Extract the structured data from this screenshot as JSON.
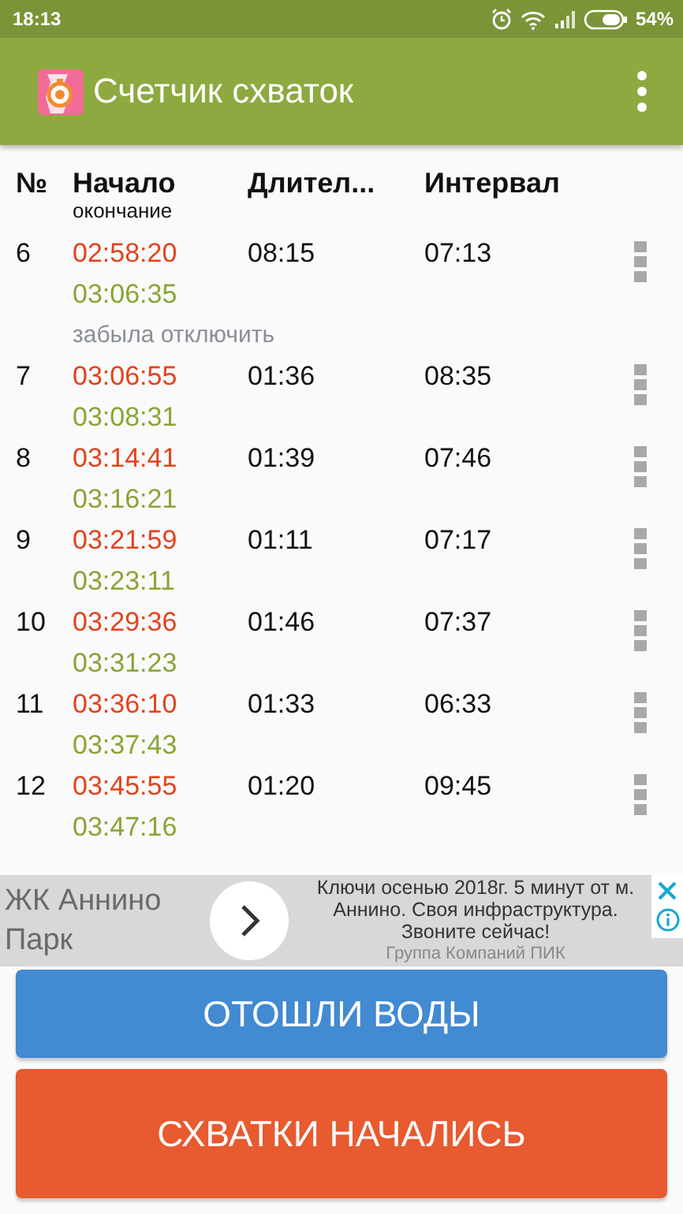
{
  "status_bar": {
    "time": "18:13",
    "battery": "54%"
  },
  "app_bar": {
    "title": "Счетчик схваток"
  },
  "table": {
    "columns": [
      {
        "label": "№"
      },
      {
        "label": "Начало",
        "sublabel": "окончание"
      },
      {
        "label": "Длител..."
      },
      {
        "label": "Интервал"
      }
    ],
    "rows": [
      {
        "number": "6",
        "start": "02:58:20",
        "end": "03:06:35",
        "duration": "08:15",
        "interval": "07:13",
        "note": "забыла отключить"
      },
      {
        "number": "7",
        "start": "03:06:55",
        "end": "03:08:31",
        "duration": "01:36",
        "interval": "08:35"
      },
      {
        "number": "8",
        "start": "03:14:41",
        "end": "03:16:21",
        "duration": "01:39",
        "interval": "07:46"
      },
      {
        "number": "9",
        "start": "03:21:59",
        "end": "03:23:11",
        "duration": "01:11",
        "interval": "07:17"
      },
      {
        "number": "10",
        "start": "03:29:36",
        "end": "03:31:23",
        "duration": "01:46",
        "interval": "07:37"
      },
      {
        "number": "11",
        "start": "03:36:10",
        "end": "03:37:43",
        "duration": "01:33",
        "interval": "06:33"
      },
      {
        "number": "12",
        "start": "03:45:55",
        "end": "03:47:16",
        "duration": "01:20",
        "interval": "09:45"
      }
    ]
  },
  "ad": {
    "title": "ЖК Аннино Парк",
    "text": "Ключи осенью 2018г. 5 минут от м. Аннино. Своя инфраструктура. Звоните сейчас!",
    "advertiser": "Группа Компаний ПИК"
  },
  "buttons": [
    {
      "label": "ОТОШЛИ ВОДЫ",
      "kind": "secondary"
    },
    {
      "label": "СХВАТКИ НАЧАЛИСЬ",
      "kind": "primary"
    }
  ]
}
